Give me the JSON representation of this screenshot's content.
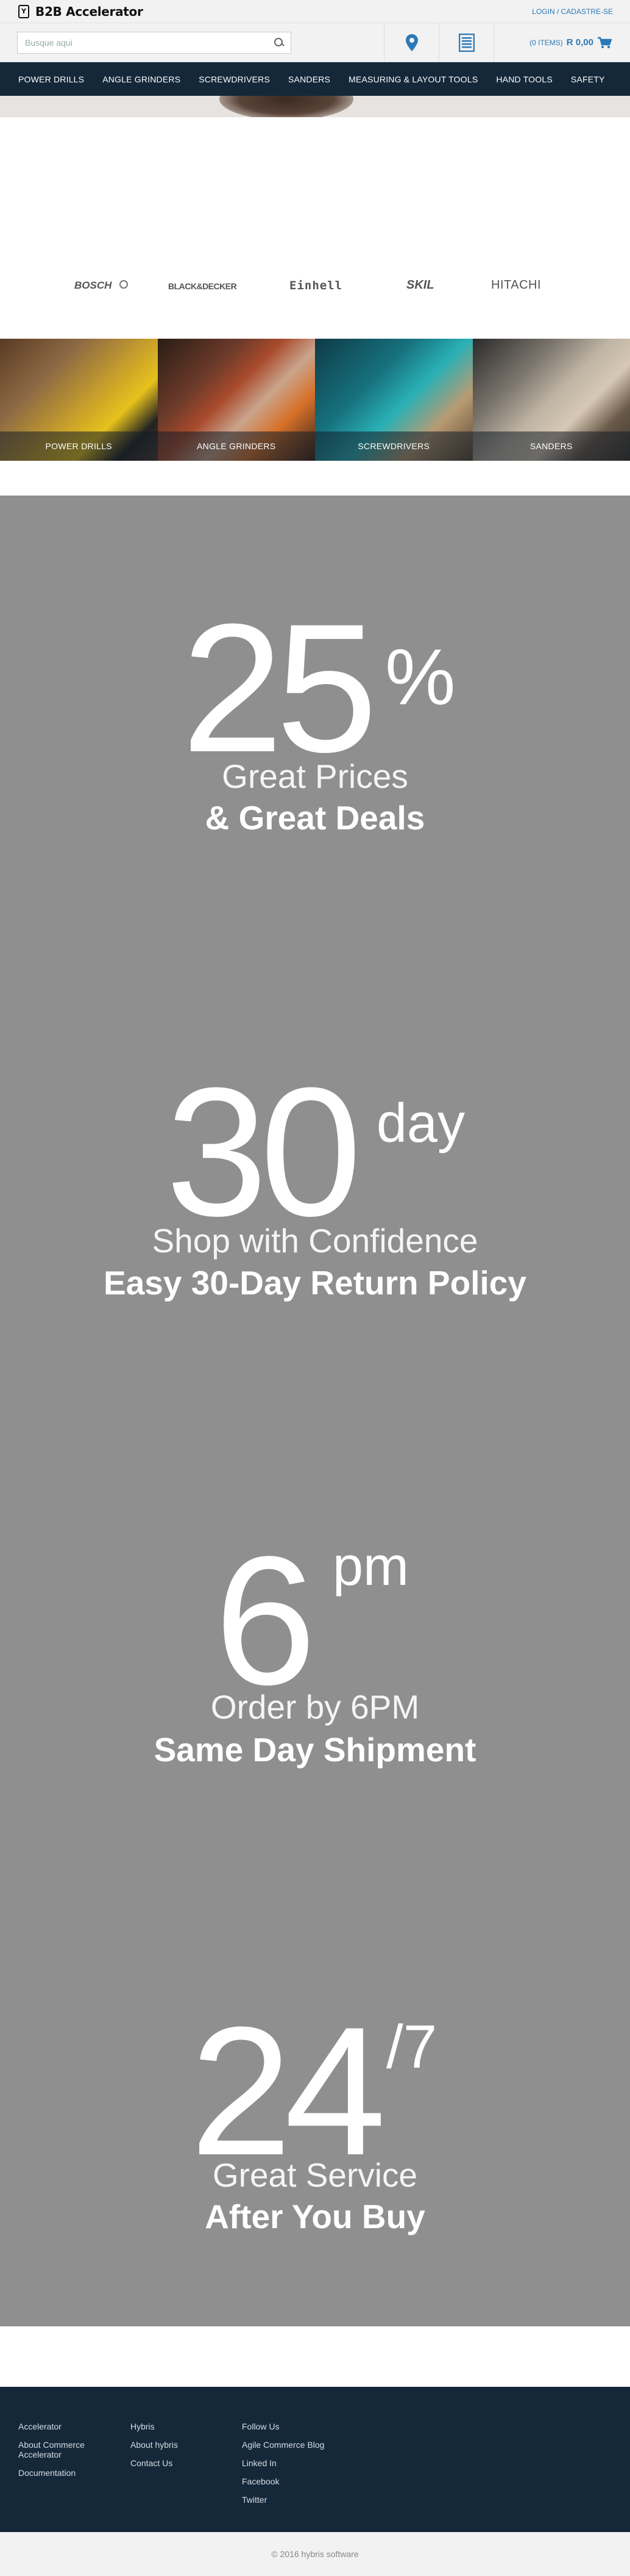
{
  "header": {
    "logo_text": "B2B Accelerator",
    "logo_mark": "Y",
    "login_link": "LOGIN / CADASTRE-SE"
  },
  "search": {
    "placeholder": "Busque aqui"
  },
  "cart": {
    "items": "(0 ITEMS)",
    "total": "R 0,00"
  },
  "nav": {
    "items": [
      "POWER DRILLS",
      "ANGLE GRINDERS",
      "SCREWDRIVERS",
      "SANDERS",
      "MEASURING & LAYOUT TOOLS",
      "HAND TOOLS",
      "SAFETY"
    ]
  },
  "brands": [
    "BOSCH",
    "BLACK&DECKER",
    "Einhell",
    "SKIL",
    "HITACHI"
  ],
  "categories": [
    "POWER DRILLS",
    "ANGLE GRINDERS",
    "SCREWDRIVERS",
    "SANDERS"
  ],
  "promos": [
    {
      "big": "25",
      "sup": "%",
      "line1": "Great Prices",
      "line2": "& Great Deals"
    },
    {
      "big": "30",
      "sup": "day",
      "line1": "Shop with Confidence",
      "line2": "Easy 30-Day Return Policy"
    },
    {
      "big": "6",
      "sup": "pm",
      "line1": "Order by 6PM",
      "line2": "Same Day Shipment"
    },
    {
      "big": "24",
      "sup": "/7",
      "line1": "Great Service",
      "line2": "After You Buy"
    }
  ],
  "footer": {
    "col1": [
      "Accelerator",
      "About Commerce Accelerator",
      "Documentation"
    ],
    "col2": [
      "Hybris",
      "About hybris",
      "Contact Us"
    ],
    "col3": [
      "Follow Us",
      "Agile Commerce Blog",
      "Linked In",
      "Facebook",
      "Twitter"
    ],
    "copyright": "© 2016 hybris software"
  },
  "colors": {
    "nav_bg": "#14283a",
    "accent": "#2c79b5",
    "promo_bg": "#8f8f8f"
  },
  "icons": [
    "search-icon",
    "location-pin-icon",
    "order-form-icon",
    "cart-icon"
  ]
}
